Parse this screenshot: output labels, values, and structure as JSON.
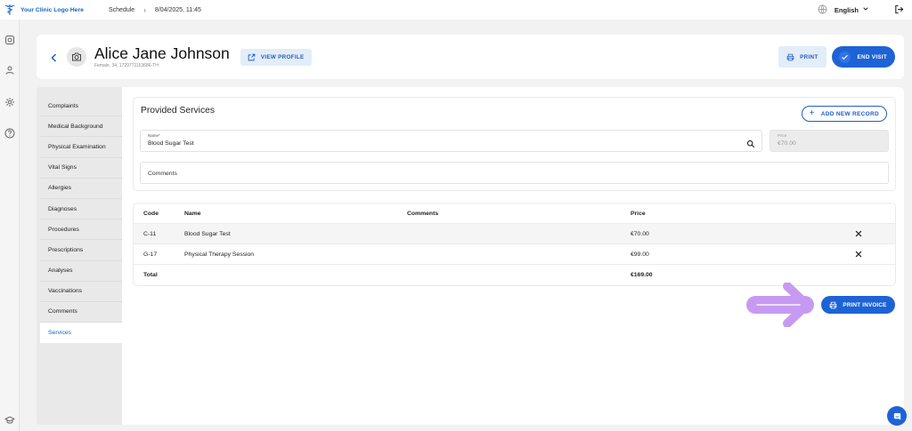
{
  "topbar": {
    "logo_text": "Your Clinic Logo Here",
    "breadcrumb": "Schedule",
    "datetime": "8/04/2025, 11:45",
    "language": "English"
  },
  "patient": {
    "name": "Alice Jane Johnson",
    "meta": "Female, 34, 1729771153686-TH"
  },
  "header_actions": {
    "view_profile": "VIEW PROFILE",
    "print": "PRINT",
    "end_visit": "END VISIT"
  },
  "sections": [
    {
      "label": "Complaints"
    },
    {
      "label": "Medical Background"
    },
    {
      "label": "Physical Examination"
    },
    {
      "label": "Vital Signs"
    },
    {
      "label": "Allergies"
    },
    {
      "label": "Diagnoses"
    },
    {
      "label": "Procedures"
    },
    {
      "label": "Prescriptions"
    },
    {
      "label": "Analyses"
    },
    {
      "label": "Vaccinations"
    },
    {
      "label": "Comments"
    },
    {
      "label": "Services",
      "active": true
    }
  ],
  "services_form": {
    "title": "Provided Services",
    "add_label": "ADD NEW RECORD",
    "name_label": "Name*",
    "name_value": "Blood Sugar Test",
    "price_label": "Price",
    "price_value": "€70.00",
    "comments_placeholder": "Comments"
  },
  "table": {
    "columns": [
      "Code",
      "Name",
      "Comments",
      "Price"
    ],
    "rows": [
      {
        "code": "C-11",
        "name": "Blood Sugar Test",
        "comments": "",
        "price": "€70.00"
      },
      {
        "code": "G-17",
        "name": "Physical Therapy Session",
        "comments": "",
        "price": "€99.00"
      }
    ],
    "total_label": "Total",
    "total_value": "€169.00"
  },
  "print_invoice": "PRINT INVOICE",
  "colors": {
    "accent": "#1e63d6",
    "arrow": "#c79af2"
  }
}
